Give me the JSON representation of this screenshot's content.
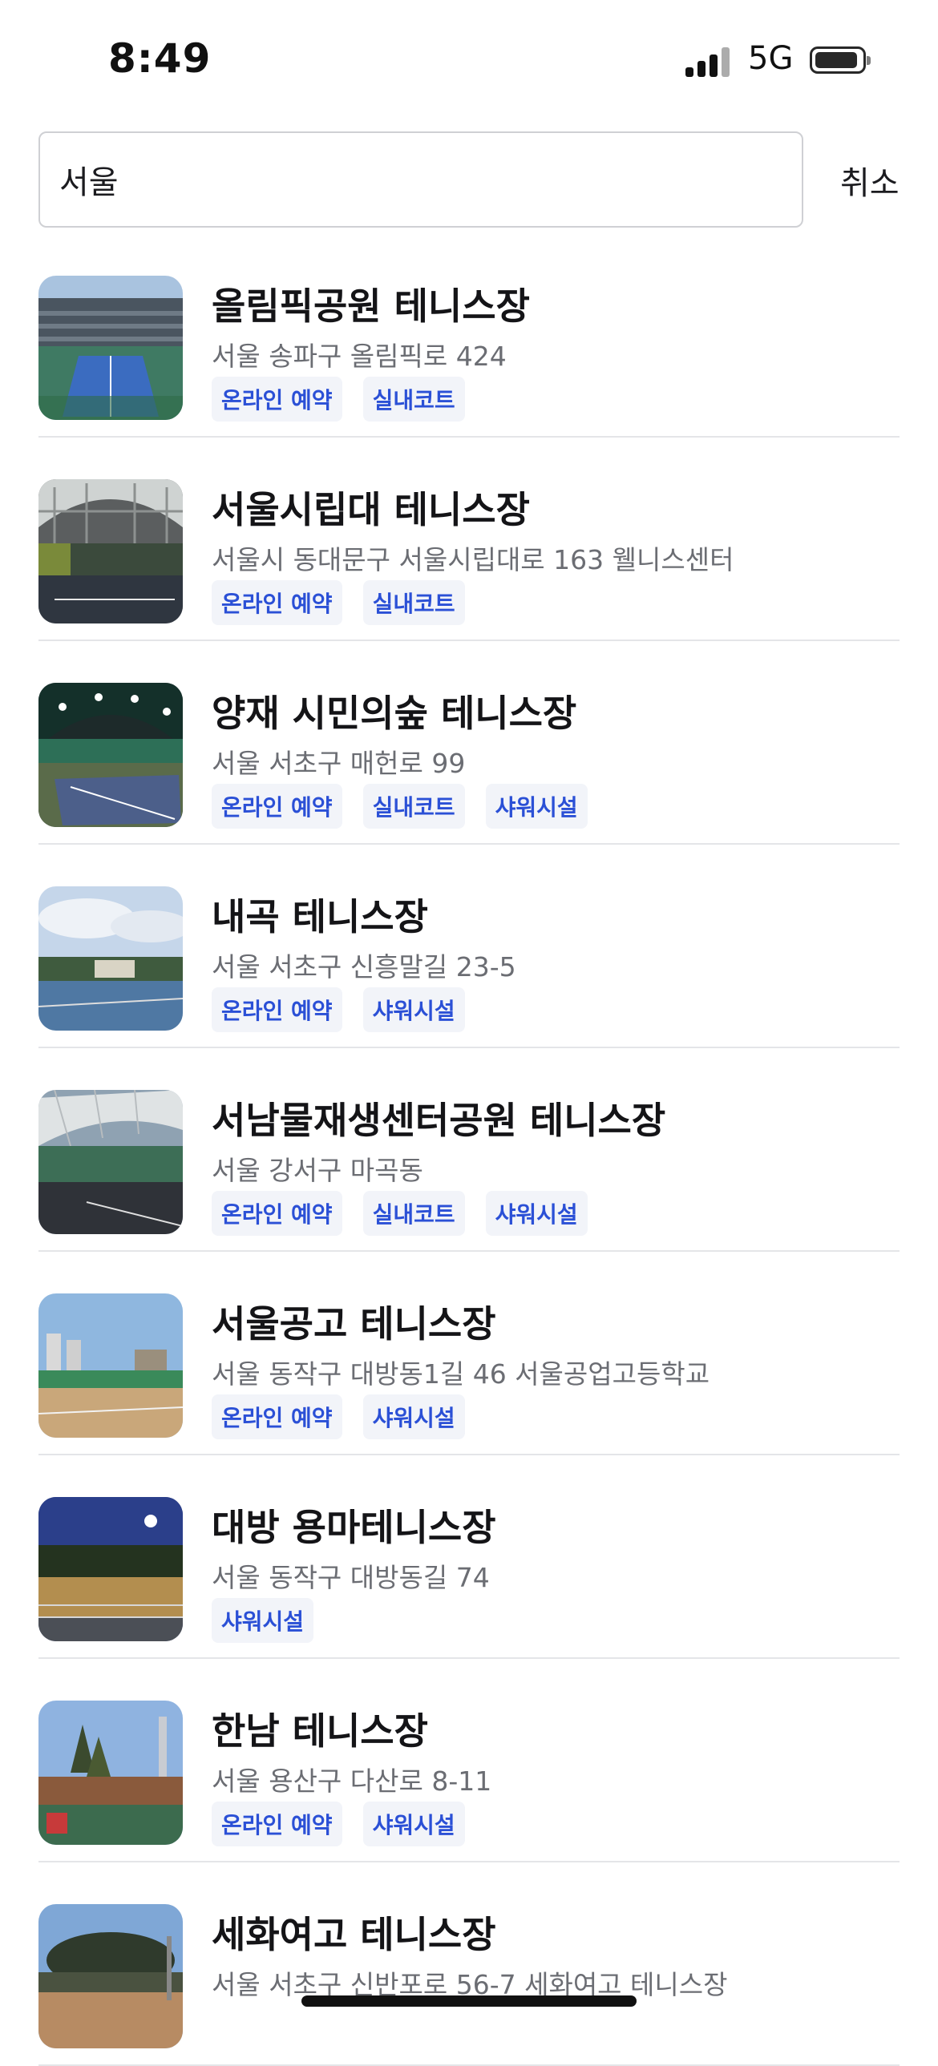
{
  "status_bar": {
    "time": "8:49",
    "network": "5G"
  },
  "search": {
    "query": "서울",
    "cancel_label": "취소"
  },
  "results": [
    {
      "name": "올림픽공원 테니스장",
      "address": "서울 송파구 올림픽로 424",
      "tags": [
        "온라인 예약",
        "실내코트"
      ],
      "thumbnail": "stadium-court-photo"
    },
    {
      "name": "서울시립대 테니스장",
      "address": "서울시 동대문구 서울시립대로 163 웰니스센터",
      "tags": [
        "온라인 예약",
        "실내코트"
      ],
      "thumbnail": "indoor-dome-court-photo"
    },
    {
      "name": "양재 시민의숲 테니스장",
      "address": "서울 서초구 매헌로 99",
      "tags": [
        "온라인 예약",
        "실내코트",
        "샤워시설"
      ],
      "thumbnail": "indoor-lit-court-photo"
    },
    {
      "name": "내곡 테니스장",
      "address": "서울 서초구 신흥말길 23-5",
      "tags": [
        "온라인 예약",
        "샤워시설"
      ],
      "thumbnail": "outdoor-blue-court-photo"
    },
    {
      "name": "서남물재생센터공원 테니스장",
      "address": "서울 강서구 마곡동",
      "tags": [
        "온라인 예약",
        "실내코트",
        "샤워시설"
      ],
      "thumbnail": "canopy-court-photo"
    },
    {
      "name": "서울공고 테니스장",
      "address": "서울 동작구 대방동1길 46 서울공업고등학교",
      "tags": [
        "온라인 예약",
        "샤워시설"
      ],
      "thumbnail": "clay-court-photo"
    },
    {
      "name": "대방 용마테니스장",
      "address": "서울 동작구 대방동길 74",
      "tags": [
        "샤워시설"
      ],
      "thumbnail": "night-court-photo"
    },
    {
      "name": "한남 테니스장",
      "address": "서울 용산구 다산로 8-11",
      "tags": [
        "온라인 예약",
        "샤워시설"
      ],
      "thumbnail": "hill-court-photo"
    },
    {
      "name": "세화여고 테니스장",
      "address": "서울 서초구 신반포로 56-7 세화여고 테니스장",
      "tags": [],
      "thumbnail": "school-court-photo"
    }
  ],
  "colors": {
    "tag_text": "#2b50d6",
    "tag_bg": "#f2f4f9",
    "divider": "#e4e5e8"
  }
}
